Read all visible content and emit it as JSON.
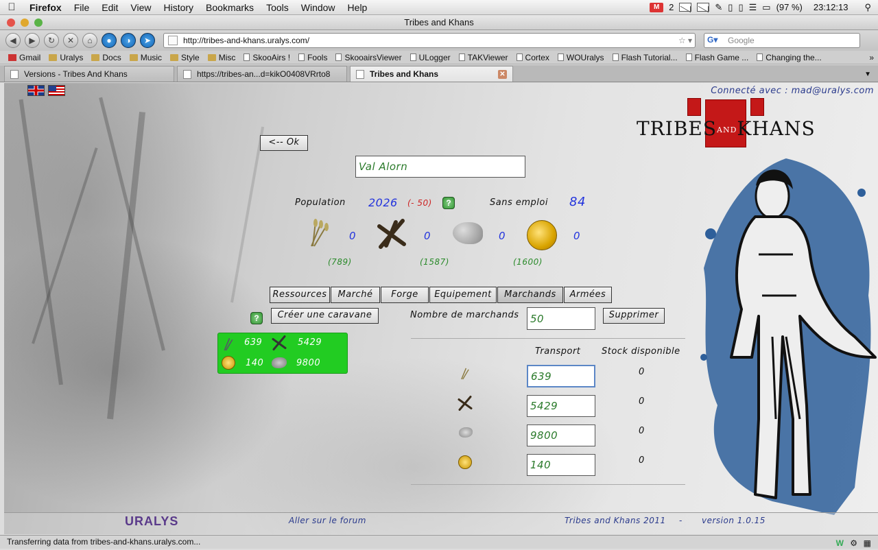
{
  "menubar": {
    "app": "Firefox",
    "items": [
      "File",
      "Edit",
      "View",
      "History",
      "Bookmarks",
      "Tools",
      "Window",
      "Help"
    ],
    "mail_count": "2",
    "battery": "(97 %)",
    "clock": "23:12:13"
  },
  "window": {
    "title": "Tribes and Khans"
  },
  "toolbar": {
    "url": "http://tribes-and-khans.uralys.com/",
    "search_placeholder": "Google"
  },
  "bookmarks": [
    {
      "label": "Gmail",
      "icon": "gmail-icon"
    },
    {
      "label": "Uralys",
      "icon": "folder-icon"
    },
    {
      "label": "Docs",
      "icon": "folder-icon"
    },
    {
      "label": "Music",
      "icon": "folder-icon"
    },
    {
      "label": "Style",
      "icon": "folder-icon"
    },
    {
      "label": "Misc",
      "icon": "folder-icon"
    },
    {
      "label": "SkooAirs !",
      "icon": "page-icon"
    },
    {
      "label": "Fools",
      "icon": "page-icon"
    },
    {
      "label": "SkooairsViewer",
      "icon": "page-icon"
    },
    {
      "label": "ULogger",
      "icon": "page-icon"
    },
    {
      "label": "TAKViewer",
      "icon": "page-icon"
    },
    {
      "label": "Cortex",
      "icon": "page-icon"
    },
    {
      "label": "WOUralys",
      "icon": "page-icon"
    },
    {
      "label": "Flash Tutorial...",
      "icon": "page-icon"
    },
    {
      "label": "Flash Game ...",
      "icon": "page-icon"
    },
    {
      "label": "Changing the...",
      "icon": "page-icon"
    }
  ],
  "tabs": [
    {
      "label": "Versions - Tribes And Khans",
      "active": false
    },
    {
      "label": "https://tribes-an...d=kikO0408VRrto8",
      "active": false
    },
    {
      "label": "Tribes and Khans",
      "active": true
    }
  ],
  "game": {
    "connected": "Connecté avec : mad@uralys.com",
    "logo_left": "TRIBES",
    "logo_and": "AND",
    "logo_right": "KHANS",
    "ok_button": "<-- Ok",
    "city_name": "Val Alorn",
    "population_label": "Population",
    "population_value": "2026",
    "population_delta": "(- 50)",
    "unemployed_label": "Sans emploi",
    "unemployed_value": "84",
    "resources": [
      {
        "name": "wheat",
        "count": "0",
        "stock": "(789)"
      },
      {
        "name": "wood",
        "count": "0",
        "stock": "(1587)"
      },
      {
        "name": "stone",
        "count": "0",
        "stock": ""
      },
      {
        "name": "gold",
        "count": "0",
        "stock": "(1600)"
      }
    ],
    "tabs": [
      "Ressources",
      "Marché",
      "Forge",
      "Equipement",
      "Marchands",
      "Armées"
    ],
    "create_caravan": "Créer une caravane",
    "caravan": {
      "wheat": "639",
      "wood": "5429",
      "gold": "140",
      "stone": "9800"
    },
    "merchants_label": "Nombre de marchands",
    "merchants_value": "50",
    "delete_button": "Supprimer",
    "col_transport": "Transport",
    "col_stock": "Stock disponible",
    "transport_rows": [
      {
        "res": "wheat",
        "value": "639",
        "stock": "0"
      },
      {
        "res": "wood",
        "value": "5429",
        "stock": "0"
      },
      {
        "res": "stone",
        "value": "9800",
        "stock": "0"
      },
      {
        "res": "gold",
        "value": "140",
        "stock": "0"
      }
    ],
    "footer_brand": "URALYS",
    "footer_forum": "Aller sur le forum",
    "footer_copyright": "Tribes and Khans 2011",
    "footer_dash": "-",
    "footer_version": "version 1.0.15"
  },
  "status": "Transferring data from tribes-and-khans.uralys.com..."
}
